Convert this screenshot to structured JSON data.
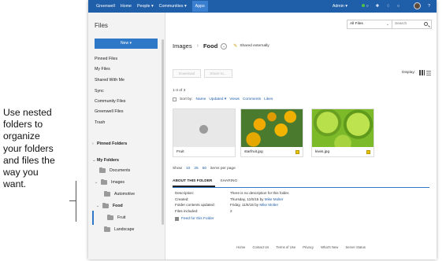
{
  "annotation": {
    "lines": [
      "Use nested",
      "folders to",
      "organize",
      "your folders",
      "and files the",
      "way you",
      "want."
    ]
  },
  "topnav": {
    "brand": "Greenwell",
    "items": [
      "Home",
      "People ▾",
      "Communities ▾",
      "Apps"
    ],
    "user": "Admin ▾"
  },
  "sidebar": {
    "title": "Files",
    "new_label": "New ▾",
    "links": [
      "Pinned Files",
      "My Files",
      "Shared With Me",
      "Sync",
      "Community Files",
      "Greenwell Files",
      "Trash"
    ],
    "pinned_folders": "Pinned Folders",
    "my_folders": "My Folders",
    "folders": {
      "documents": "Documents",
      "images": "Images",
      "automotive": "Automotive",
      "food": "Food",
      "fruit": "Fruit",
      "landscape": "Landscape"
    }
  },
  "main": {
    "filter_value": "All Files",
    "search_placeholder": "Search",
    "breadcrumb_parent": "Images",
    "breadcrumb_current": "Food",
    "shared_label": "Shared externally",
    "btn_download": "Download",
    "btn_share": "Share to...",
    "display_label": "Display:",
    "count": "1-3 of 3",
    "sort_label": "Sort by:",
    "sort_options": [
      "Name",
      "Updated ▾",
      "Views",
      "Comments",
      "Likes"
    ],
    "cards": [
      {
        "name": "Fruit"
      },
      {
        "name": "starfruit.jpg"
      },
      {
        "name": "kiwis.jpg"
      }
    ],
    "pager_show": "Show",
    "pager_sizes": [
      "10",
      "25",
      "50"
    ],
    "pager_suffix": "items per page",
    "tabs": [
      "ABOUT THIS FOLDER",
      "SHARING"
    ],
    "about": [
      {
        "k": "Description:",
        "v": "There is no description for this folder."
      },
      {
        "k": "Created:",
        "v": "Thursday, 11/5/15 by",
        "user": "Mike Molter"
      },
      {
        "k": "Folder contents updated:",
        "v": "Friday, 11/6/15 by",
        "user": "Mike Molter"
      },
      {
        "k": "Files included:",
        "v": "2"
      }
    ],
    "feed": "Feed for this Folder"
  },
  "footer": [
    "Home",
    "Contact Us",
    "Terms of Use",
    "Privacy",
    "What's New",
    "Server Status"
  ],
  "colors": {
    "nav": "#1f5ea8",
    "accent": "#2f78c8"
  }
}
